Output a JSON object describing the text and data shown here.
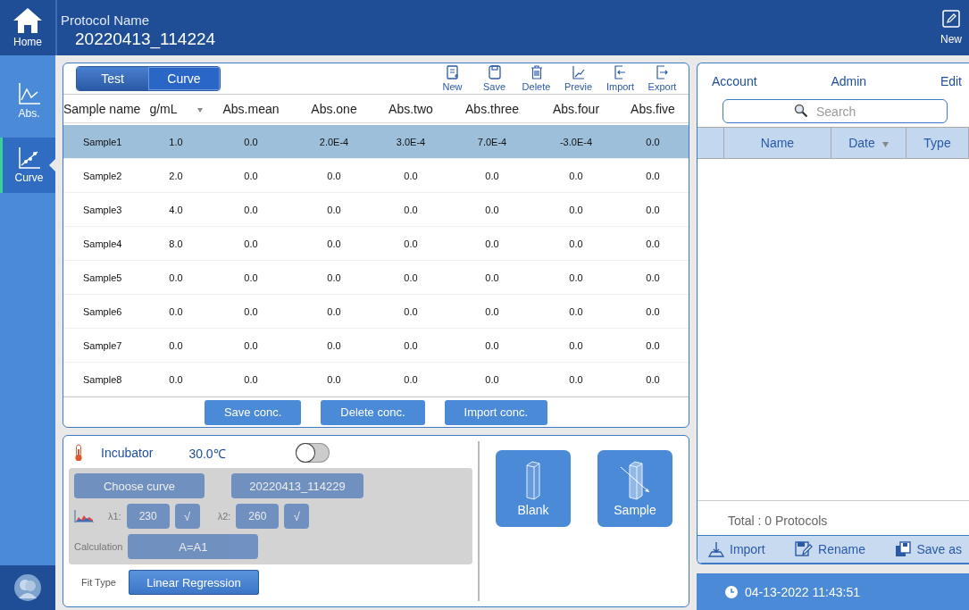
{
  "sidebar": {
    "home": {
      "label": "Home"
    },
    "items": [
      {
        "label": "Abs.",
        "kind": "abs",
        "selected": false
      },
      {
        "label": "Curve",
        "kind": "curve",
        "selected": true
      }
    ]
  },
  "header": {
    "label": "Protocol Name",
    "protocol_name": "20220413_114224",
    "new_label": "New"
  },
  "tabs": [
    {
      "label": "Test",
      "selected": false
    },
    {
      "label": "Curve",
      "selected": true
    }
  ],
  "toolbar": [
    {
      "label": "New",
      "kind": "new"
    },
    {
      "label": "Save",
      "kind": "save"
    },
    {
      "label": "Delete",
      "kind": "delete"
    },
    {
      "label": "Previe",
      "kind": "preview"
    },
    {
      "label": "Import",
      "kind": "import"
    },
    {
      "label": "Export",
      "kind": "export"
    }
  ],
  "table": {
    "columns": [
      {
        "label": "Sample name",
        "sort": false
      },
      {
        "label": "g/mL",
        "sort": true
      },
      {
        "label": "Abs.mean",
        "sort": false
      },
      {
        "label": "Abs.one",
        "sort": false
      },
      {
        "label": "Abs.two",
        "sort": false
      },
      {
        "label": "Abs.three",
        "sort": false
      },
      {
        "label": "Abs.four",
        "sort": false
      },
      {
        "label": "Abs.five",
        "sort": false
      }
    ],
    "rows": [
      {
        "selected": true,
        "cells": [
          "Sample1",
          "1.0",
          "0.0",
          "2.0E-4",
          "3.0E-4",
          "7.0E-4",
          "-3.0E-4",
          "0.0"
        ]
      },
      {
        "selected": false,
        "cells": [
          "Sample2",
          "2.0",
          "0.0",
          "0.0",
          "0.0",
          "0.0",
          "0.0",
          "0.0"
        ]
      },
      {
        "selected": false,
        "cells": [
          "Sample3",
          "4.0",
          "0.0",
          "0.0",
          "0.0",
          "0.0",
          "0.0",
          "0.0"
        ]
      },
      {
        "selected": false,
        "cells": [
          "Sample4",
          "8.0",
          "0.0",
          "0.0",
          "0.0",
          "0.0",
          "0.0",
          "0.0"
        ]
      },
      {
        "selected": false,
        "cells": [
          "Sample5",
          "0.0",
          "0.0",
          "0.0",
          "0.0",
          "0.0",
          "0.0",
          "0.0"
        ]
      },
      {
        "selected": false,
        "cells": [
          "Sample6",
          "0.0",
          "0.0",
          "0.0",
          "0.0",
          "0.0",
          "0.0",
          "0.0"
        ]
      },
      {
        "selected": false,
        "cells": [
          "Sample7",
          "0.0",
          "0.0",
          "0.0",
          "0.0",
          "0.0",
          "0.0",
          "0.0"
        ]
      },
      {
        "selected": false,
        "cells": [
          "Sample8",
          "0.0",
          "0.0",
          "0.0",
          "0.0",
          "0.0",
          "0.0",
          "0.0"
        ]
      }
    ]
  },
  "table_actions": [
    "Save conc.",
    "Delete conc.",
    "Import conc."
  ],
  "incubator": {
    "label": "Incubator",
    "temperature": "30.0℃",
    "on": false
  },
  "curve_settings": {
    "disabled": true,
    "choose_label": "Choose curve",
    "curve_name": "20220413_114229",
    "l1_label": "λ1:",
    "l1_value": "230",
    "l1_confirm": "√",
    "l2_label": "λ2:",
    "l2_value": "260",
    "l2_confirm": "√",
    "calc_label": "Calculation",
    "calc_value": "A=A1"
  },
  "fit": {
    "label": "Fit Type",
    "value": "Linear Regression"
  },
  "measure_buttons": [
    {
      "label": "Blank",
      "kind": "blank"
    },
    {
      "label": "Sample",
      "kind": "sample"
    }
  ],
  "account": {
    "label": "Account",
    "value": "Admin",
    "edit": "Edit"
  },
  "search": {
    "placeholder": "Search"
  },
  "protocol_table": {
    "columns": [
      {
        "label": "Name",
        "sort": false
      },
      {
        "label": "Date",
        "sort": true
      },
      {
        "label": "Type",
        "sort": false
      }
    ]
  },
  "total": "Total : 0 Protocols",
  "protocol_actions": [
    {
      "label": "Import",
      "kind": "import"
    },
    {
      "label": "Rename",
      "kind": "rename"
    },
    {
      "label": "Save as",
      "kind": "saveas"
    }
  ],
  "datetime": "04-13-2022 11:43:51"
}
